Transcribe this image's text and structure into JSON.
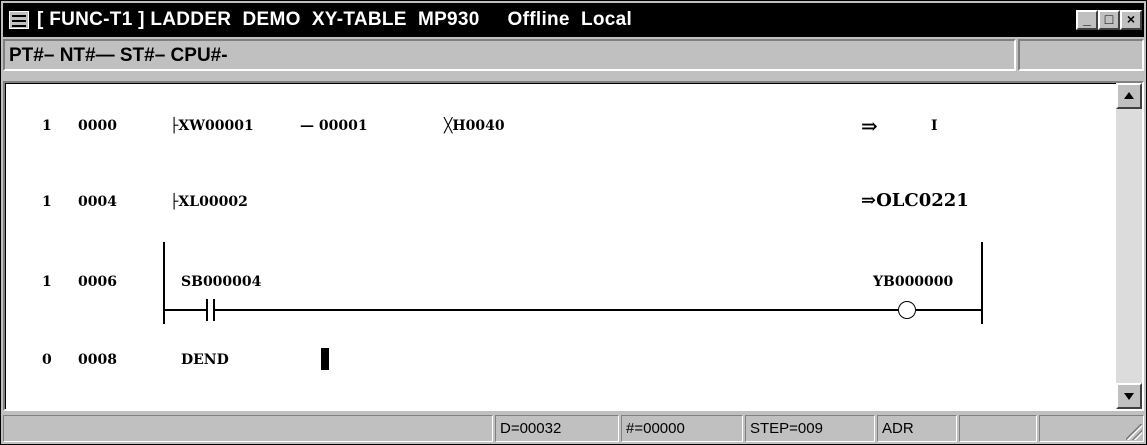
{
  "window": {
    "title": "[ FUNC-T1 ] LADDER  DEMO  XY-TABLE  MP930     Offline  Local",
    "buttons": {
      "minimize": "_",
      "maximize": "□",
      "close": "×"
    }
  },
  "info_line": "PT#– NT#— ST#– CPU#-",
  "ladder": {
    "rows": [
      {
        "block": "1",
        "address": "0000",
        "a1": "├XW00001",
        "a2": "— 00001",
        "a3": "╳H0040",
        "a4": "⇒",
        "a5": "I"
      },
      {
        "block": "1",
        "address": "0004",
        "a1": "├XL00002",
        "a4": "⇒OLC0221"
      },
      {
        "block": "1",
        "address": "0006",
        "contact": "SB000004",
        "coil": "YB000000"
      },
      {
        "block": "0",
        "address": "0008",
        "a1": "DEND"
      }
    ]
  },
  "status": {
    "d": "D=00032",
    "hash": "#=00000",
    "step": "STEP=009",
    "mode": "ADR"
  }
}
